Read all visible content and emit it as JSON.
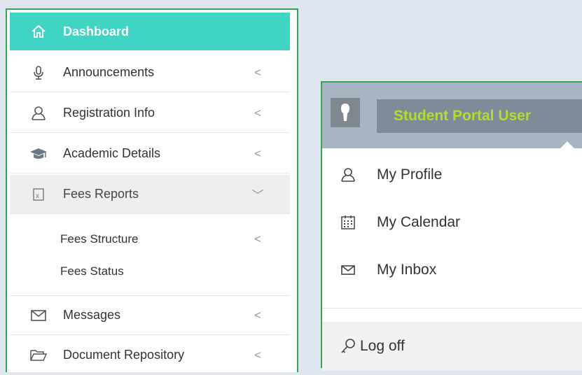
{
  "sidebar": {
    "items": [
      {
        "label": "Dashboard",
        "icon": "home-icon"
      },
      {
        "label": "Announcements",
        "icon": "microphone-icon",
        "chevron": "<"
      },
      {
        "label": "Registration Info",
        "icon": "user-icon",
        "chevron": "<"
      },
      {
        "label": "Academic Details",
        "icon": "graduation-cap-icon",
        "chevron": "<"
      },
      {
        "label": "Fees Reports",
        "icon": "excel-file-icon",
        "chevron": "﹀"
      },
      {
        "label": "Messages",
        "icon": "envelope-icon",
        "chevron": "<"
      },
      {
        "label": "Document Repository",
        "icon": "folder-open-icon",
        "chevron": "<"
      }
    ],
    "subitems": [
      {
        "label": "Fees Structure",
        "chevron": "<"
      },
      {
        "label": "Fees Status"
      }
    ]
  },
  "user_menu": {
    "user_name": "Student Portal User",
    "items": [
      {
        "label": "My Profile",
        "icon": "user-icon"
      },
      {
        "label": "My Calendar",
        "icon": "calendar-icon"
      },
      {
        "label": "My Inbox",
        "icon": "envelope-icon"
      }
    ],
    "logoff_label": "Log off",
    "logoff_icon": "key-icon"
  },
  "colors": {
    "active": "#3fd4c4",
    "username": "#aee02a",
    "frame": "#2fa84f"
  }
}
